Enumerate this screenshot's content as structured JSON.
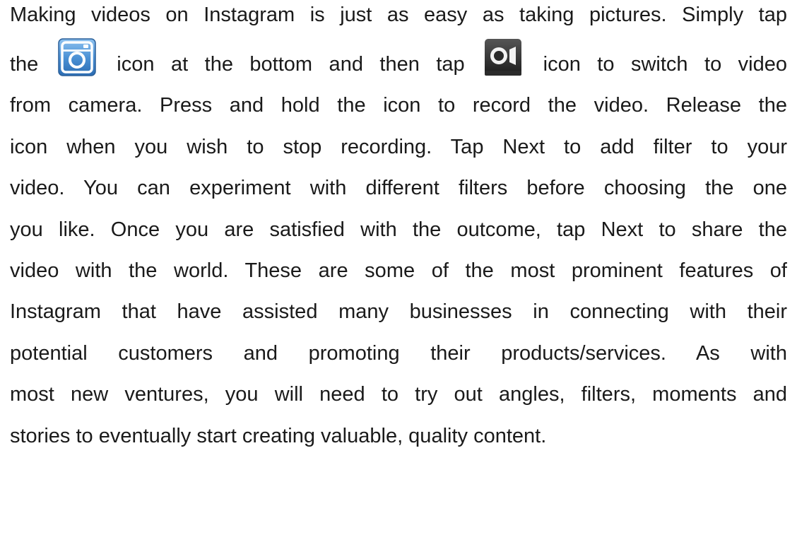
{
  "document": {
    "paragraph": {
      "lines": [
        "Making videos on Instagram is just as easy as taking pictures. Simply tap",
        {
          "before_icon1": "the",
          "between_icons": "icon at the bottom and then tap",
          "after_icon2": "icon to switch to video"
        },
        "from camera. Press and hold the icon to record the video. Release the",
        "icon when you wish to stop recording. Tap Next to add filter to your",
        "video. You can experiment with different filters before choosing the one",
        "you like. Once you are satisfied with the outcome, tap Next to share the",
        "video with the world. These are some of the most prominent features of",
        "Instagram that have assisted many businesses in connecting with their",
        "potential customers and promoting their products/services. As with",
        "most new ventures, you will need to try out angles, filters, moments and",
        "stories to eventually start creating valuable, quality content."
      ]
    },
    "icons": {
      "camera_icon": "instagram-camera-icon",
      "video_icon": "video-camera-icon",
      "camera_icon_color": "#3d7fc4",
      "video_icon_color": "#2f2f2f"
    }
  }
}
